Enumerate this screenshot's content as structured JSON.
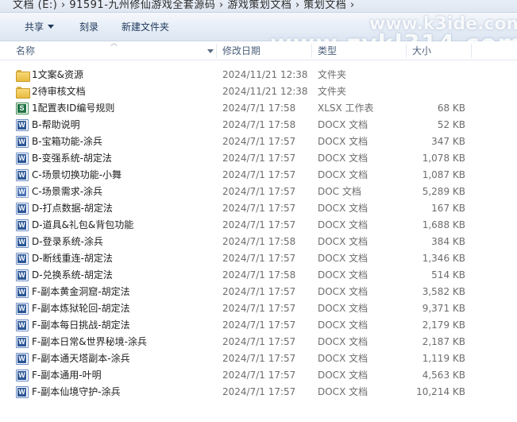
{
  "address_bar": {
    "path_text": "文档 (E:) › 91591-九州修仙游戏全套源码 › 游戏策划文档 › 策划文档 ›"
  },
  "toolbar": {
    "share_label": "共享",
    "burn_label": "刻录",
    "new_folder_label": "新建文件夹"
  },
  "watermark": {
    "top": "www.k3ide.com",
    "main": "www.zykl314.com"
  },
  "columns": {
    "name": "名称",
    "date": "修改日期",
    "type": "类型",
    "size": "大小"
  },
  "files": [
    {
      "name": "1文案&资源",
      "date": "2024/11/21 12:38",
      "type": "文件夹",
      "size": "",
      "icon": "folder-icon"
    },
    {
      "name": "2待审核文档",
      "date": "2024/11/21 12:38",
      "type": "文件夹",
      "size": "",
      "icon": "folder-icon"
    },
    {
      "name": "1配置表ID编号规则",
      "date": "2024/7/1 17:58",
      "type": "XLSX 工作表",
      "size": "68 KB",
      "icon": "excel-icon"
    },
    {
      "name": "B-帮助说明",
      "date": "2024/7/1 17:58",
      "type": "DOCX 文档",
      "size": "52 KB",
      "icon": "word-icon"
    },
    {
      "name": "B-宝箱功能-涂兵",
      "date": "2024/7/1 17:57",
      "type": "DOCX 文档",
      "size": "347 KB",
      "icon": "word-icon"
    },
    {
      "name": "B-变强系统-胡定法",
      "date": "2024/7/1 17:57",
      "type": "DOCX 文档",
      "size": "1,078 KB",
      "icon": "word-icon"
    },
    {
      "name": "C-场景切换功能-小舞",
      "date": "2024/7/1 17:57",
      "type": "DOCX 文档",
      "size": "1,087 KB",
      "icon": "word-icon"
    },
    {
      "name": "C-场景需求-涂兵",
      "date": "2024/7/1 17:57",
      "type": "DOC 文档",
      "size": "5,289 KB",
      "icon": "doc-icon"
    },
    {
      "name": "D-打点数据-胡定法",
      "date": "2024/7/1 17:57",
      "type": "DOCX 文档",
      "size": "167 KB",
      "icon": "word-icon"
    },
    {
      "name": "D-道具&礼包&背包功能",
      "date": "2024/7/1 17:57",
      "type": "DOCX 文档",
      "size": "1,688 KB",
      "icon": "word-icon"
    },
    {
      "name": "D-登录系统-涂兵",
      "date": "2024/7/1 17:58",
      "type": "DOCX 文档",
      "size": "384 KB",
      "icon": "word-icon"
    },
    {
      "name": "D-断线重连-胡定法",
      "date": "2024/7/1 17:57",
      "type": "DOCX 文档",
      "size": "1,346 KB",
      "icon": "word-icon"
    },
    {
      "name": "D-兑换系统-胡定法",
      "date": "2024/7/1 17:58",
      "type": "DOCX 文档",
      "size": "514 KB",
      "icon": "word-icon"
    },
    {
      "name": "F-副本黄金洞窟-胡定法",
      "date": "2024/7/1 17:57",
      "type": "DOCX 文档",
      "size": "3,582 KB",
      "icon": "word-icon"
    },
    {
      "name": "F-副本炼狱轮回-胡定法",
      "date": "2024/7/1 17:57",
      "type": "DOCX 文档",
      "size": "9,371 KB",
      "icon": "word-icon"
    },
    {
      "name": "F-副本每日挑战-胡定法",
      "date": "2024/7/1 17:57",
      "type": "DOCX 文档",
      "size": "2,179 KB",
      "icon": "word-icon"
    },
    {
      "name": "F-副本日常&世界秘境-涂兵",
      "date": "2024/7/1 17:57",
      "type": "DOCX 文档",
      "size": "2,187 KB",
      "icon": "word-icon"
    },
    {
      "name": "F-副本通天塔副本-涂兵",
      "date": "2024/7/1 17:57",
      "type": "DOCX 文档",
      "size": "1,119 KB",
      "icon": "word-icon"
    },
    {
      "name": "F-副本通用-叶明",
      "date": "2024/7/1 17:57",
      "type": "DOCX 文档",
      "size": "4,563 KB",
      "icon": "word-icon"
    },
    {
      "name": "F-副本仙境守护-涂兵",
      "date": "2024/7/1 17:57",
      "type": "DOCX 文档",
      "size": "10,214 KB",
      "icon": "word-icon"
    }
  ]
}
